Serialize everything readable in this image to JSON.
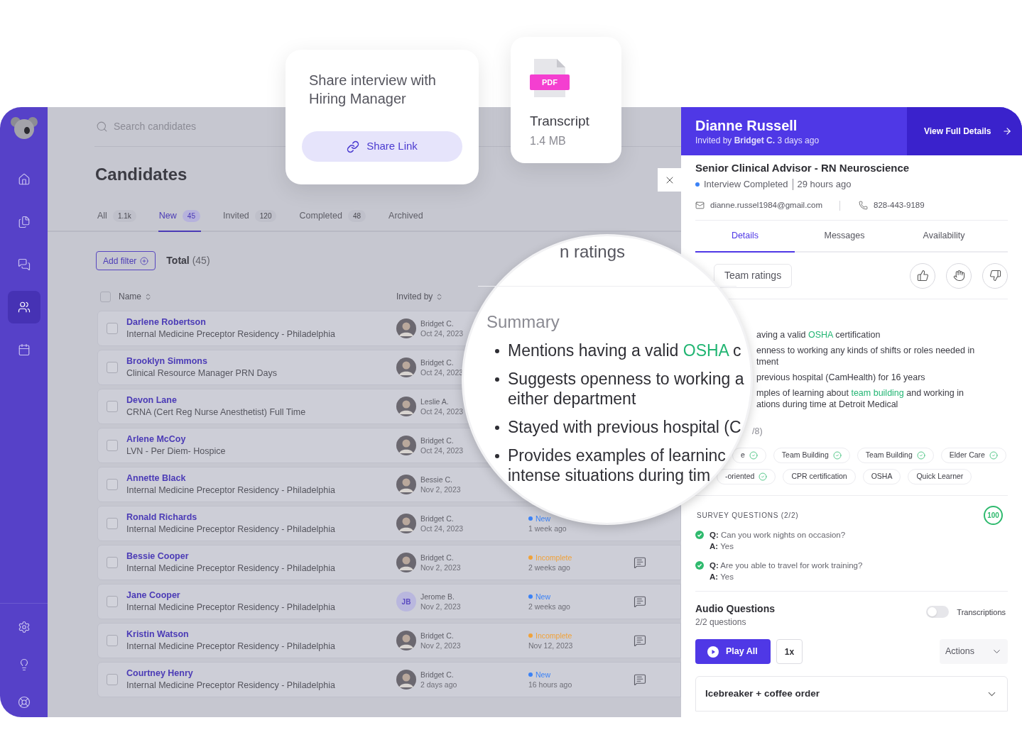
{
  "share_card": {
    "title": "Share interview with Hiring Manager",
    "button": "Share Link"
  },
  "file_card": {
    "badge": "PDF",
    "name": "Transcript",
    "size": "1.4 MB"
  },
  "nav": [
    {
      "kind": "home",
      "selected": false
    },
    {
      "kind": "documents",
      "selected": false
    },
    {
      "kind": "chat",
      "selected": false
    },
    {
      "kind": "people",
      "selected": true
    },
    {
      "kind": "calendar",
      "selected": false
    }
  ],
  "nav_bottom": [
    {
      "kind": "settings",
      "selected": false
    },
    {
      "kind": "idea",
      "selected": false
    },
    {
      "kind": "support",
      "selected": false
    }
  ],
  "search": {
    "placeholder": "Search candidates"
  },
  "page_title": "Candidates",
  "tabs": [
    {
      "label": "All",
      "count": "1.1k",
      "selected": false
    },
    {
      "label": "New",
      "count": "45",
      "selected": true
    },
    {
      "label": "Invited",
      "count": "120",
      "selected": false
    },
    {
      "label": "Completed",
      "count": "48",
      "selected": false
    },
    {
      "label": "Archived",
      "selected": false
    }
  ],
  "filter_button": "Add filter",
  "total": {
    "label": "Total",
    "count": "(45)"
  },
  "table": {
    "columns": [
      "Name",
      "Invited by"
    ],
    "select_all_checked": false,
    "rows": [
      {
        "name": "Darlene Robertson",
        "role": "Internal Medicine Preceptor Residency - Philadelphia",
        "checked": false,
        "avatar": {
          "kind": "photo"
        },
        "inviter": "Bridget C.",
        "date": "Oct 24, 2023",
        "message_icon": false
      },
      {
        "name": "Brooklyn Simmons",
        "role": "Clinical Resource Manager PRN Days",
        "checked": false,
        "avatar": {
          "kind": "photo"
        },
        "inviter": "Bridget C.",
        "date": "Oct 24, 2023",
        "message_icon": false
      },
      {
        "name": "Devon Lane",
        "role": "CRNA (Cert Reg Nurse Anesthetist) Full Time",
        "checked": false,
        "avatar": {
          "kind": "photo"
        },
        "inviter": "Leslie A.",
        "date": "Oct 24, 2023",
        "message_icon": false
      },
      {
        "name": "Arlene McCoy",
        "role": "LVN - Per Diem- Hospice",
        "checked": false,
        "avatar": {
          "kind": "photo"
        },
        "inviter": "Bridget C.",
        "date": "Oct 24, 2023",
        "message_icon": false
      },
      {
        "name": "Annette Black",
        "role": "Internal Medicine Preceptor Residency - Philadelphia",
        "checked": false,
        "avatar": {
          "kind": "photo"
        },
        "inviter": "Bessie C.",
        "date": "Nov 2, 2023",
        "message_icon": false
      },
      {
        "name": "Ronald Richards",
        "role": "Internal Medicine Preceptor Residency - Philadelphia",
        "checked": false,
        "avatar": {
          "kind": "photo"
        },
        "inviter": "Bridget C.",
        "date": "Oct 24, 2023",
        "status": {
          "label": "New",
          "color": "#3b82f6",
          "time": "1 week ago"
        },
        "message_icon": false
      },
      {
        "name": "Bessie Cooper",
        "role": "Internal Medicine Preceptor Residency - Philadelphia",
        "checked": false,
        "avatar": {
          "kind": "photo"
        },
        "inviter": "Bridget C.",
        "date": "Nov 2, 2023",
        "status": {
          "label": "Incomplete",
          "color": "#f0a23a",
          "time": "2 weeks ago"
        },
        "message_icon": true
      },
      {
        "name": "Jane Cooper",
        "role": "Internal Medicine Preceptor Residency - Philadelphia",
        "checked": false,
        "avatar": {
          "kind": "initials",
          "text": "JB"
        },
        "inviter": "Jerome B.",
        "date": "Nov 2, 2023",
        "status": {
          "label": "New",
          "color": "#3b82f6",
          "time": "2 weeks ago"
        },
        "message_icon": true
      },
      {
        "name": "Kristin Watson",
        "role": "Internal Medicine Preceptor Residency - Philadelphia",
        "checked": false,
        "avatar": {
          "kind": "photo"
        },
        "inviter": "Bridget C.",
        "date": "Nov 2, 2023",
        "status": {
          "label": "Incomplete",
          "color": "#f0a23a",
          "time": "Nov 12, 2023"
        },
        "message_icon": true
      },
      {
        "name": "Courtney Henry",
        "role": "Internal Medicine Preceptor Residency - Philadelphia",
        "checked": false,
        "avatar": {
          "kind": "photo"
        },
        "inviter": "Bridget C.",
        "date": "2 days ago",
        "status": {
          "label": "New",
          "color": "#3b82f6",
          "time": "16 hours ago"
        },
        "message_icon": true
      }
    ]
  },
  "magnifier": {
    "chip": "n ratings",
    "heading": "Summary",
    "bullets": [
      {
        "lines": [
          [
            "Mentions having a valid ",
            {
              "highlight": "OSHA"
            },
            " c"
          ]
        ]
      },
      {
        "lines": [
          [
            "Suggests openness to working a"
          ],
          [
            "either department"
          ]
        ]
      },
      {
        "lines": [
          [
            "Stayed with previous hospital (C"
          ]
        ]
      },
      {
        "lines": [
          [
            "Provides examples of learninc"
          ],
          [
            "intense situations during tim"
          ]
        ]
      }
    ]
  },
  "candidate": {
    "name": "Dianne Russell",
    "invited_line": "Invited by **Bridget C.** 3 days ago",
    "view_button": "View Full Details",
    "job_title": "Senior Clinical Advisor - RN Neuroscience",
    "status": {
      "label": "Interview Completed",
      "color": "#3b82f6"
    },
    "status_time": "29 hours ago",
    "email": "dianne.russel1984@gmail.com",
    "phone": "828-443-9189"
  },
  "detail_tabs": [
    {
      "label": "Details",
      "selected": true
    },
    {
      "label": "Messages",
      "selected": false
    },
    {
      "label": "Availability",
      "selected": false
    }
  ],
  "team_ratings": "Team ratings",
  "summary": [
    {
      "lines": [
        [
          "aving a valid ",
          {
            "highlight": "OSHA"
          },
          " certification"
        ]
      ]
    },
    {
      "lines": [
        [
          "enness to working any kinds of shifts or roles needed in"
        ],
        [
          "tment"
        ]
      ]
    },
    {
      "lines": [
        [
          "previous hospital (CamHealth) for 16 years"
        ]
      ]
    },
    {
      "lines": [
        [
          "mples of learning about ",
          {
            "highlight": "team building"
          },
          " and working in"
        ],
        [
          "ations during time at Detroit Medical"
        ]
      ]
    }
  ],
  "skills_label": "/8)",
  "tags": [
    [
      {
        "label": "e",
        "checked": true
      },
      {
        "label": "Team Building",
        "checked": true
      },
      {
        "label": "Team Building",
        "checked": true
      },
      {
        "label": "Elder Care",
        "checked": true
      }
    ],
    [
      {
        "label": "-oriented",
        "checked": true
      },
      {
        "label": "CPR certification",
        "checked": false
      },
      {
        "label": "OSHA",
        "checked": false
      },
      {
        "label": "Quick Learner",
        "checked": false
      }
    ]
  ],
  "survey": {
    "title": "SURVEY QUESTIONS (2/2)",
    "score": "100",
    "questions": [
      {
        "q_label": "Q:",
        "question": "Can you work nights on occasion?",
        "a_label": "A:",
        "answer": "Yes",
        "checked": true
      },
      {
        "q_label": "Q:",
        "question": "Are you able to travel for work training?",
        "a_label": "A:",
        "answer": "Yes",
        "checked": true
      }
    ]
  },
  "audio": {
    "title": "Audio Questions",
    "subtitle": "2/2 questions",
    "transcriptions": {
      "label": "Transcriptions",
      "on": false
    },
    "play_button": "Play All",
    "speed": "1x",
    "actions": "Actions",
    "item": "Icebreaker + coffee order"
  }
}
